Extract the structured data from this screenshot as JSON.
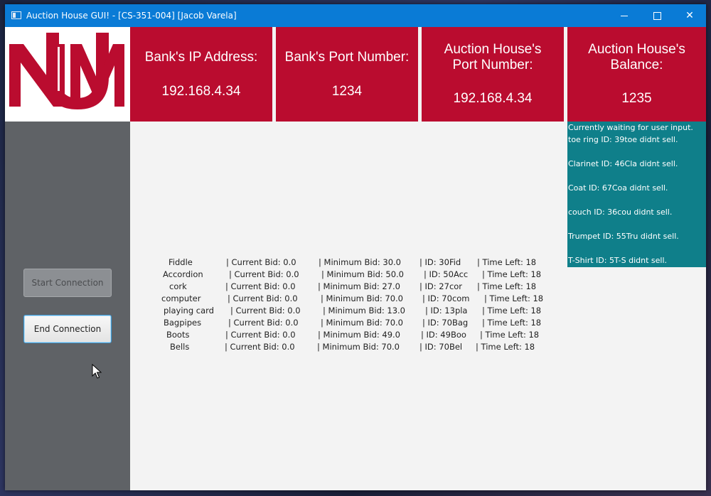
{
  "window": {
    "title": "Auction House GUI! - [CS-351-004] [Jacob Varela]",
    "minimize": "minimize-icon",
    "maximize": "maximize-icon",
    "close": "✕"
  },
  "logo": {
    "text": "UNM"
  },
  "header": {
    "bank_ip_label": "Bank's IP Address:",
    "bank_ip_value": "192.168.4.34",
    "bank_port_label": "Bank's Port Number:",
    "bank_port_value": "1234",
    "ah_port_label": "Auction House's\nPort Number:",
    "ah_port_value": "192.168.4.34",
    "ah_balance_label": "Auction House's\n Balance:",
    "ah_balance_value": "1235"
  },
  "sidebar": {
    "start_button": "Start Connection",
    "end_button": "End Connection"
  },
  "log": [
    "Currently waiting for user input.",
    "toe ring ID: 39toe didnt sell.",
    "",
    "Clarinet ID: 46Cla didnt sell.",
    "",
    "Coat ID: 67Coa didnt sell.",
    "",
    "couch ID: 36cou didnt sell.",
    "",
    "Trumpet ID: 55Tru didnt sell.",
    "",
    "T-Shirt ID: 5T-S didnt sell."
  ],
  "items": [
    {
      "name": "Fiddle",
      "current": "| Current Bid: 0.0",
      "minimum": "| Minimum Bid: 30.0",
      "id": "| ID: 30Fid",
      "time": "| Time Left: 18"
    },
    {
      "name": "Accordion",
      "current": "| Current Bid: 0.0",
      "minimum": "| Minimum Bid: 50.0",
      "id": "| ID: 50Acc",
      "time": "| Time Left: 18"
    },
    {
      "name": "cork",
      "current": "| Current Bid: 0.0",
      "minimum": "| Minimum Bid: 27.0",
      "id": "| ID: 27cor",
      "time": "| Time Left: 18"
    },
    {
      "name": "computer",
      "current": "| Current Bid: 0.0",
      "minimum": "| Minimum Bid: 70.0",
      "id": "| ID: 70com",
      "time": "| Time Left: 18"
    },
    {
      "name": "playing card",
      "current": "| Current Bid: 0.0",
      "minimum": "| Minimum Bid: 13.0",
      "id": "| ID: 13pla",
      "time": "| Time Left: 18"
    },
    {
      "name": "Bagpipes",
      "current": "| Current Bid: 0.0",
      "minimum": "| Minimum Bid: 70.0",
      "id": "| ID: 70Bag",
      "time": "| Time Left: 18"
    },
    {
      "name": "Boots",
      "current": "| Current Bid: 0.0",
      "minimum": "| Minimum Bid: 49.0",
      "id": "| ID: 49Boo",
      "time": "| Time Left: 18"
    },
    {
      "name": "Bells",
      "current": "| Current Bid: 0.0",
      "minimum": "| Minimum Bid: 70.0",
      "id": "| ID: 70Bel",
      "time": "| Time Left: 18"
    }
  ],
  "colors": {
    "brand_red": "#ba0c2f",
    "log_teal": "#0f7f8a",
    "sidebar_gray": "#5f6266",
    "titlebar_blue": "#0a7bd6"
  }
}
